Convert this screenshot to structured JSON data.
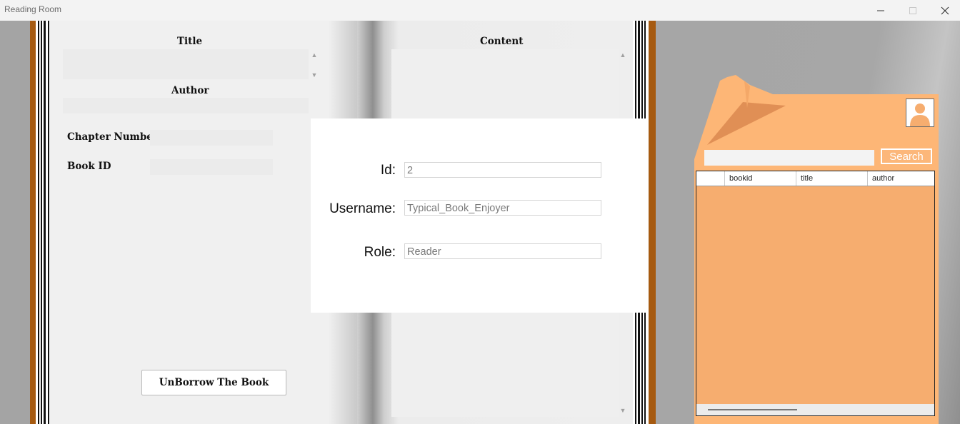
{
  "window": {
    "title": "Reading Room",
    "controls": [
      "minimize-icon",
      "maximize-icon",
      "close-icon"
    ]
  },
  "left_page": {
    "title_label": "Title",
    "author_label": "Author",
    "chapter_number_label": "Chapter Number",
    "book_id_label": "Book ID",
    "unborrow_button": "UnBorrow The Book"
  },
  "right_page": {
    "content_label": "Content"
  },
  "profile": {
    "id_label": "Id:",
    "id_value": "2",
    "username_label": "Username:",
    "username_value": "Typical_Book_Enjoyer",
    "role_label": "Role:",
    "role_value": "Reader"
  },
  "search_panel": {
    "search_value": "",
    "search_button": "Search",
    "columns": [
      "",
      "bookid",
      "title",
      "author"
    ],
    "rows": []
  },
  "colors": {
    "card": "#fdb676",
    "grid_bg": "#f6ad6f",
    "book_cover": "#a65a10"
  }
}
